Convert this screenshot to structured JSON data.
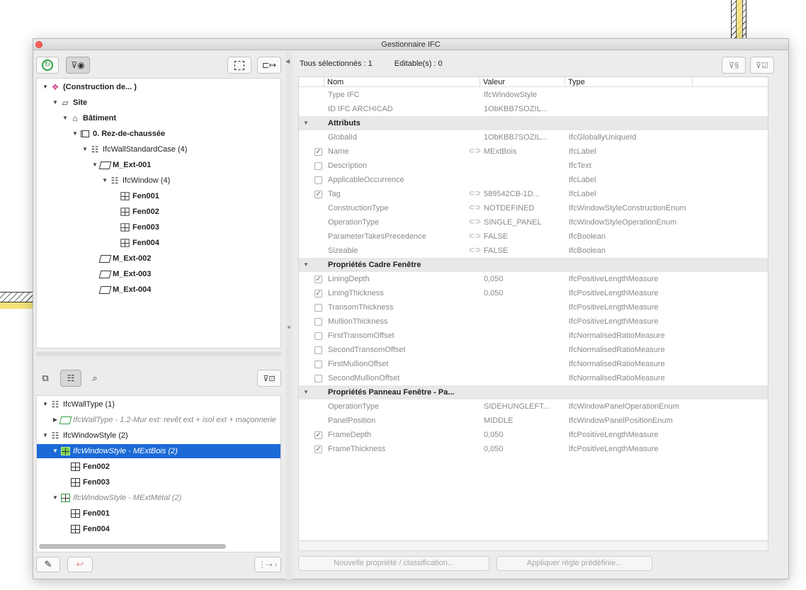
{
  "window": {
    "title": "Gestionnaire IFC"
  },
  "left_toolbar": {
    "refresh_icon": "refresh-icon",
    "filter_view_icon": "filter-eye-icon",
    "select_icon": "select-element-icon",
    "export_icon": "export-icon"
  },
  "tree": [
    {
      "label": "(Construction de... )",
      "bold": true,
      "depth": 0,
      "icon": "project-icon"
    },
    {
      "label": "Site",
      "bold": true,
      "depth": 1,
      "icon": "site-icon"
    },
    {
      "label": "Bâtiment",
      "bold": true,
      "depth": 2,
      "icon": "building-icon"
    },
    {
      "label": "0. Rez-de-chaussée",
      "bold": true,
      "depth": 3,
      "icon": "storey-icon"
    },
    {
      "label": "IfcWallStandardCase (4)",
      "bold": false,
      "depth": 4,
      "icon": "type-group-icon"
    },
    {
      "label": "M_Ext-001",
      "bold": true,
      "depth": 5,
      "icon": "wall-icon"
    },
    {
      "label": "IfcWindow (4)",
      "bold": false,
      "depth": 6,
      "icon": "type-group-icon"
    },
    {
      "label": "Fen001",
      "bold": true,
      "depth": 7,
      "icon": "window-icon"
    },
    {
      "label": "Fen002",
      "bold": true,
      "depth": 7,
      "icon": "window-icon"
    },
    {
      "label": "Fen003",
      "bold": true,
      "depth": 7,
      "icon": "window-icon"
    },
    {
      "label": "Fen004",
      "bold": true,
      "depth": 7,
      "icon": "window-icon"
    },
    {
      "label": "M_Ext-002",
      "bold": true,
      "depth": 5,
      "icon": "wall-icon"
    },
    {
      "label": "M_Ext-003",
      "bold": true,
      "depth": 5,
      "icon": "wall-icon"
    },
    {
      "label": "M_Ext-004",
      "bold": true,
      "depth": 5,
      "icon": "wall-icon"
    }
  ],
  "type_tree": [
    {
      "label": "IfcWallType (1)",
      "depth": 0,
      "style": "normal",
      "icon": "type-group-icon"
    },
    {
      "label": "IfcWallType - 1.2-Mur ext: revêt ext + isol ext + maçonnerie",
      "depth": 1,
      "style": "gray",
      "icon": "wall-type-icon"
    },
    {
      "label": "IfcWindowStyle (2)",
      "depth": 0,
      "style": "normal",
      "icon": "type-group-icon"
    },
    {
      "label": "IfcWindowStyle - MExtBois (2)",
      "depth": 1,
      "style": "selected",
      "icon": "window-style-icon"
    },
    {
      "label": "Fen002",
      "depth": 2,
      "style": "bold",
      "icon": "window-icon"
    },
    {
      "label": "Fen003",
      "depth": 2,
      "style": "bold",
      "icon": "window-icon"
    },
    {
      "label": "IfcWindowStyle - MExtMétal (2)",
      "depth": 1,
      "style": "gray",
      "icon": "window-style-icon"
    },
    {
      "label": "Fen001",
      "depth": 2,
      "style": "bold",
      "icon": "window-icon"
    },
    {
      "label": "Fen004",
      "depth": 2,
      "style": "bold",
      "icon": "window-icon"
    }
  ],
  "stats": {
    "selected": "Tous sélectionnés : 1",
    "editable": "Editable(s) : 0"
  },
  "columns": {
    "name": "Nom",
    "value": "Valeur",
    "type": "Type"
  },
  "properties": [
    {
      "kind": "row",
      "name": "Type IFC",
      "value": "IfcWindowStyle",
      "type": ""
    },
    {
      "kind": "row",
      "name": "ID IFC ARCHICAD",
      "value": "1ObKBB7SOZIL...",
      "type": ""
    },
    {
      "kind": "group",
      "name": "Attributs"
    },
    {
      "kind": "row",
      "name": "GlobalId",
      "value": "1ObKBB7SOZIL...",
      "type": "IfcGloballyUniqueId"
    },
    {
      "kind": "row",
      "check": "checked",
      "link": true,
      "name": "Name",
      "value": "MExtBois",
      "type": "IfcLabel"
    },
    {
      "kind": "row",
      "check": "empty",
      "name": "Description",
      "value": "",
      "type": "IfcText"
    },
    {
      "kind": "row",
      "check": "empty",
      "name": "ApplicableOccurrence",
      "value": "",
      "type": "IfcLabel"
    },
    {
      "kind": "row",
      "check": "checked",
      "link": true,
      "name": "Tag",
      "value": "589542CB-1D...",
      "type": "IfcLabel"
    },
    {
      "kind": "row",
      "link": true,
      "name": "ConstructionType",
      "value": "NOTDEFINED",
      "type": "IfcWindowStyleConstructionEnum"
    },
    {
      "kind": "row",
      "link": true,
      "name": "OperationType",
      "value": "SINGLE_PANEL",
      "type": "IfcWindowStyleOperationEnum"
    },
    {
      "kind": "row",
      "link": true,
      "name": "ParameterTakesPrecedence",
      "value": "FALSE",
      "type": "IfcBoolean"
    },
    {
      "kind": "row",
      "link": true,
      "name": "Sizeable",
      "value": "FALSE",
      "type": "IfcBoolean"
    },
    {
      "kind": "group",
      "name": "Propriétés Cadre Fenêtre"
    },
    {
      "kind": "row",
      "check": "checked",
      "name": "LiningDepth",
      "value": "0,050",
      "type": "IfcPositiveLengthMeasure"
    },
    {
      "kind": "row",
      "check": "checked",
      "name": "LiningThickness",
      "value": "0,050",
      "type": "IfcPositiveLengthMeasure"
    },
    {
      "kind": "row",
      "check": "empty",
      "name": "TransomThickness",
      "value": "",
      "type": "IfcPositiveLengthMeasure"
    },
    {
      "kind": "row",
      "check": "empty",
      "name": "MullionThickness",
      "value": "",
      "type": "IfcPositiveLengthMeasure"
    },
    {
      "kind": "row",
      "check": "empty",
      "name": "FirstTransomOffset",
      "value": "",
      "type": "IfcNormalisedRatioMeasure"
    },
    {
      "kind": "row",
      "check": "empty",
      "name": "SecondTransomOffset",
      "value": "",
      "type": "IfcNormalisedRatioMeasure"
    },
    {
      "kind": "row",
      "check": "empty",
      "name": "FirstMullionOffset",
      "value": "",
      "type": "IfcNormalisedRatioMeasure"
    },
    {
      "kind": "row",
      "check": "empty",
      "name": "SecondMullionOffset",
      "value": "",
      "type": "IfcNormalisedRatioMeasure"
    },
    {
      "kind": "group",
      "name": "Propriétés Panneau Fenêtre - Pa..."
    },
    {
      "kind": "row",
      "name": "OperationType",
      "value": "SIDEHUNGLEFT...",
      "type": "IfcWindowPanelOperationEnum"
    },
    {
      "kind": "row",
      "name": "PanelPosition",
      "value": "MIDDLE",
      "type": "IfcWindowPanelPositionEnum"
    },
    {
      "kind": "row",
      "check": "checked",
      "name": "FrameDepth",
      "value": "0,050",
      "type": "IfcPositiveLengthMeasure"
    },
    {
      "kind": "row",
      "check": "checked",
      "name": "FrameThickness",
      "value": "0,050",
      "type": "IfcPositiveLengthMeasure"
    }
  ],
  "buttons": {
    "new_property": "Nouvelle propriété / classification...",
    "apply_rule": "Appliquer règle prédéfinie..."
  },
  "accent_color": "#1b6ad6"
}
